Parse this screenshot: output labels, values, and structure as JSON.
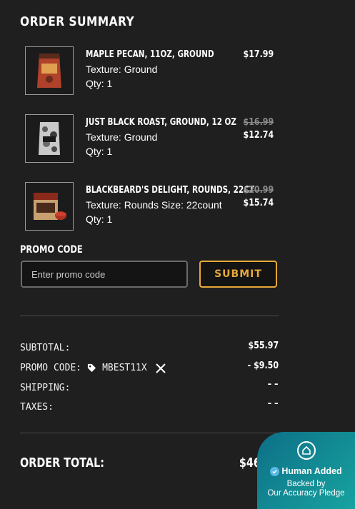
{
  "title": "ORDER SUMMARY",
  "items": [
    {
      "name": "MAPLE PECAN, 11OZ, GROUND",
      "variant": "Texture: Ground",
      "qty": "Qty: 1",
      "original_price": "",
      "price": "$17.99",
      "thumb_icon": "coffee-bag-red-icon"
    },
    {
      "name": "JUST BLACK ROAST, GROUND, 12 OZ",
      "variant": "Texture: Ground",
      "qty": "Qty: 1",
      "original_price": "$16.99",
      "price": "$12.74",
      "thumb_icon": "coffee-bag-camo-icon"
    },
    {
      "name": "BLACKBEARD'S DELIGHT, ROUNDS, 22CT",
      "variant": "Texture: Rounds  Size: 22count",
      "qty": "Qty: 1",
      "original_price": "$20.99",
      "price": "$15.74",
      "thumb_icon": "coffee-rounds-box-icon"
    }
  ],
  "promo": {
    "label": "PROMO CODE",
    "placeholder": "Enter promo code",
    "value": "",
    "submit_label": "SUBMIT"
  },
  "summary": {
    "subtotal_label": "SUBTOTAL:",
    "subtotal_value": "$55.97",
    "promo_label": "PROMO CODE:",
    "promo_code": "MBEST11X",
    "promo_value": "- $9.50",
    "shipping_label": "SHIPPING:",
    "shipping_value": "– –",
    "taxes_label": "TAXES:",
    "taxes_value": "– –",
    "total_label": "ORDER TOTAL:",
    "total_value": "$46.47"
  },
  "badge": {
    "title": "Human Added",
    "line1": "Backed by",
    "line2": "Our Accuracy Pledge",
    "icon": "house-icon"
  },
  "colors": {
    "background": "#1f1f1f",
    "accent": "#e8a93a",
    "badge_gradient_start": "#0d6f86",
    "badge_gradient_end": "#17a3a0"
  }
}
